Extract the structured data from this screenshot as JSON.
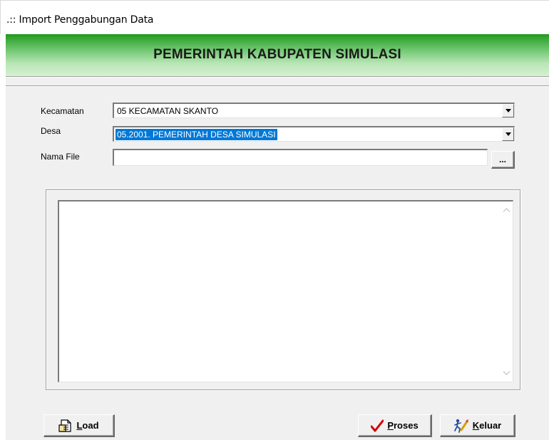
{
  "window": {
    "title": ".:: Import Penggabungan Data"
  },
  "banner": {
    "heading": "PEMERINTAH KABUPATEN SIMULASI"
  },
  "form": {
    "kecamatan": {
      "label": "Kecamatan",
      "value": "05  KECAMATAN SKANTO"
    },
    "desa": {
      "label": "Desa",
      "value": "05.2001.  PEMERINTAH DESA SIMULASI"
    },
    "nama_file": {
      "label": "Nama File",
      "value": "",
      "browse_label": "..."
    }
  },
  "log": {
    "text": ""
  },
  "buttons": {
    "load": {
      "mnemonic": "L",
      "rest": "oad"
    },
    "proses": {
      "mnemonic": "P",
      "rest": "roses"
    },
    "keluar": {
      "mnemonic": "K",
      "rest": "eluar"
    }
  },
  "colors": {
    "selection": "#0078d7",
    "banner_green": "#1f9a1f",
    "check_red": "#d10000"
  }
}
